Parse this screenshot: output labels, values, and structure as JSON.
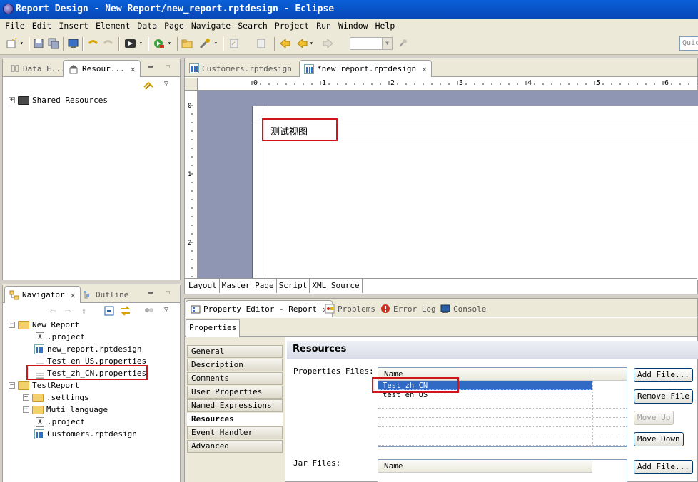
{
  "window": {
    "title": "Report Design - New Report/new_report.rptdesign - Eclipse"
  },
  "menu": [
    "File",
    "Edit",
    "Insert",
    "Element",
    "Data",
    "Page",
    "Navigate",
    "Search",
    "Project",
    "Run",
    "Window",
    "Help"
  ],
  "toolbar": {
    "quick_access": "Quick"
  },
  "left_top_panel": {
    "tabs": [
      "Data E...",
      "Resour..."
    ],
    "tree": [
      {
        "label": "Shared Resources"
      }
    ]
  },
  "navigator_panel": {
    "tabs": [
      "Navigator",
      "Outline"
    ],
    "tree": [
      {
        "label": "New Report"
      },
      {
        "label": ".project"
      },
      {
        "label": "new_report.rptdesign"
      },
      {
        "label": "Test_en_US.properties"
      },
      {
        "label": "Test_zh_CN.properties"
      },
      {
        "label": "TestReport"
      },
      {
        "label": ".settings"
      },
      {
        "label": "Muti_language"
      },
      {
        "label": ".project"
      },
      {
        "label": "Customers.rptdesign"
      }
    ]
  },
  "editor": {
    "tabs": [
      "Customers.rptdesign",
      "*new_report.rptdesign"
    ],
    "ruler_numbers": [
      "0",
      "1",
      "2",
      "3",
      "4",
      "5",
      "6"
    ],
    "vruler_numbers": [
      "0",
      "1",
      "2"
    ],
    "label_text": "测试视图",
    "bottom_tabs": [
      "Layout",
      "Master Page",
      "Script",
      "XML Source"
    ]
  },
  "bottom_panel": {
    "tabs": [
      "Property Editor - Report",
      "Problems",
      "Error Log",
      "Console"
    ],
    "subtab": "Properties",
    "categories": [
      "General",
      "Description",
      "Comments",
      "User Properties",
      "Named Expressions",
      "Resources",
      "Event Handler",
      "Advanced"
    ],
    "section_title": "Resources",
    "properties_files_label": "Properties Files:",
    "jar_files_label": "Jar Files:",
    "name_header": "Name",
    "properties_files": [
      "Test_zh_CN",
      "test_en_US"
    ],
    "buttons": {
      "add_file": "Add File...",
      "remove_file": "Remove File",
      "move_up": "Move Up",
      "move_down": "Move Down",
      "add_file_jar": "Add File..."
    }
  }
}
